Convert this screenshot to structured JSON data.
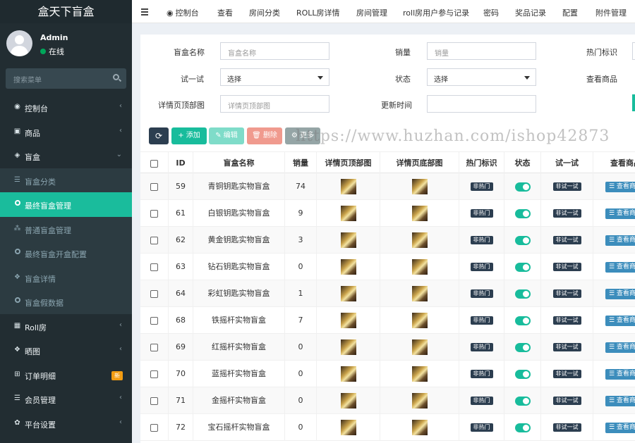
{
  "app": {
    "title": "盒天下盲盒"
  },
  "user": {
    "name": "Admin",
    "status": "在线"
  },
  "sidebar_search": {
    "placeholder": "搜索菜单"
  },
  "sidebar": {
    "items": [
      {
        "label": "控制台",
        "icon": "dashboard-icon",
        "glyph": "◉",
        "chevron": "‹"
      },
      {
        "label": "商品",
        "icon": "bag-icon",
        "glyph": "▣",
        "chevron": "‹"
      },
      {
        "label": "盲盒",
        "icon": "cube-icon",
        "glyph": "◈",
        "chevron": "⌄"
      },
      {
        "label": "盲盒分类",
        "icon": "list-icon",
        "glyph": "☰"
      },
      {
        "label": "最终盲盒管理",
        "icon": "circle-icon"
      },
      {
        "label": "普通盲盒管理",
        "icon": "cubes-icon",
        "glyph": "⁂"
      },
      {
        "label": "最终盲盒开盒配置",
        "icon": "circle-icon"
      },
      {
        "label": "盲盒详情",
        "icon": "dropbox-icon",
        "glyph": "❖"
      },
      {
        "label": "盲盒假数据",
        "icon": "circle-icon"
      },
      {
        "label": "Roll房",
        "icon": "grid-icon",
        "glyph": "▦",
        "chevron": "‹"
      },
      {
        "label": "晒图",
        "icon": "dropbox-icon",
        "glyph": "❖",
        "chevron": "‹"
      },
      {
        "label": "订单明细",
        "icon": "cart-icon",
        "glyph": "⊞",
        "badge": "新"
      },
      {
        "label": "会员管理",
        "icon": "list-icon",
        "glyph": "☰",
        "chevron": "‹"
      },
      {
        "label": "平台设置",
        "icon": "gear-icon",
        "glyph": "✿",
        "chevron": "‹"
      }
    ]
  },
  "topnav": {
    "items": [
      {
        "label": "控制台",
        "icon": "dashboard-icon",
        "glyph": "◉"
      },
      {
        "label": "查看"
      },
      {
        "label": "房间分类"
      },
      {
        "label": "ROLL房详情"
      },
      {
        "label": "房间管理"
      },
      {
        "label": "roll房用户参与记录"
      },
      {
        "label": "密码"
      },
      {
        "label": "奖品记录"
      },
      {
        "label": "配置"
      },
      {
        "label": "附件管理"
      }
    ]
  },
  "filters": {
    "name_label": "盲盒名称",
    "name_placeholder": "盲盒名称",
    "sales_label": "销量",
    "sales_placeholder": "销量",
    "hot_label": "热门标识",
    "trial_label": "试一试",
    "trial_value": "选择",
    "status_label": "状态",
    "status_value": "选择",
    "view_label": "查看商品",
    "detail_top_label": "详情页顶部图",
    "detail_top_value": "详情页顶部图",
    "update_label": "更新时间"
  },
  "watermark": "https://www.huzhan.com/ishop42873",
  "toolbar": {
    "refresh_glyph": "⟳",
    "add": "+ 添加",
    "edit": "✎ 编辑",
    "delete": "🗑 删除",
    "more": "⚙ 更多"
  },
  "table": {
    "headers": [
      "ID",
      "盲盒名称",
      "销量",
      "详情页顶部图",
      "详情页底部图",
      "热门标识",
      "状态",
      "试一试",
      "查看商品"
    ],
    "rows": [
      {
        "id": "59",
        "name": "青铜钥匙实物盲盒",
        "sales": "74",
        "hot": "非热门",
        "trial": "非试一试",
        "view": "☰ 查看商品"
      },
      {
        "id": "61",
        "name": "白银钥匙实物盲盒",
        "sales": "9",
        "hot": "非热门",
        "trial": "非试一试",
        "view": "☰ 查看商品"
      },
      {
        "id": "62",
        "name": "黄金钥匙实物盲盒",
        "sales": "3",
        "hot": "非热门",
        "trial": "非试一试",
        "view": "☰ 查看商品"
      },
      {
        "id": "63",
        "name": "钻石钥匙实物盲盒",
        "sales": "0",
        "hot": "非热门",
        "trial": "非试一试",
        "view": "☰ 查看商品"
      },
      {
        "id": "64",
        "name": "彩虹钥匙实物盲盒",
        "sales": "1",
        "hot": "非热门",
        "trial": "非试一试",
        "view": "☰ 查看商品"
      },
      {
        "id": "68",
        "name": "铁摇杆实物盲盒",
        "sales": "7",
        "hot": "非热门",
        "trial": "非试一试",
        "view": "☰ 查看商品"
      },
      {
        "id": "69",
        "name": "红摇杆实物盲盒",
        "sales": "0",
        "hot": "非热门",
        "trial": "非试一试",
        "view": "☰ 查看商品"
      },
      {
        "id": "70",
        "name": "蓝摇杆实物盲盒",
        "sales": "0",
        "hot": "非热门",
        "trial": "非试一试",
        "view": "☰ 查看商品"
      },
      {
        "id": "71",
        "name": "金摇杆实物盲盒",
        "sales": "0",
        "hot": "非热门",
        "trial": "非试一试",
        "view": "☰ 查看商品"
      },
      {
        "id": "72",
        "name": "宝石摇杆实物盲盒",
        "sales": "0",
        "hot": "非热门",
        "trial": "非试一试",
        "view": "☰ 查看商品"
      }
    ]
  },
  "colors": {
    "sidebar_bg": "#222d32",
    "accent": "#1abc9c",
    "primary": "#3c8dbc",
    "online": "#00a65a"
  }
}
